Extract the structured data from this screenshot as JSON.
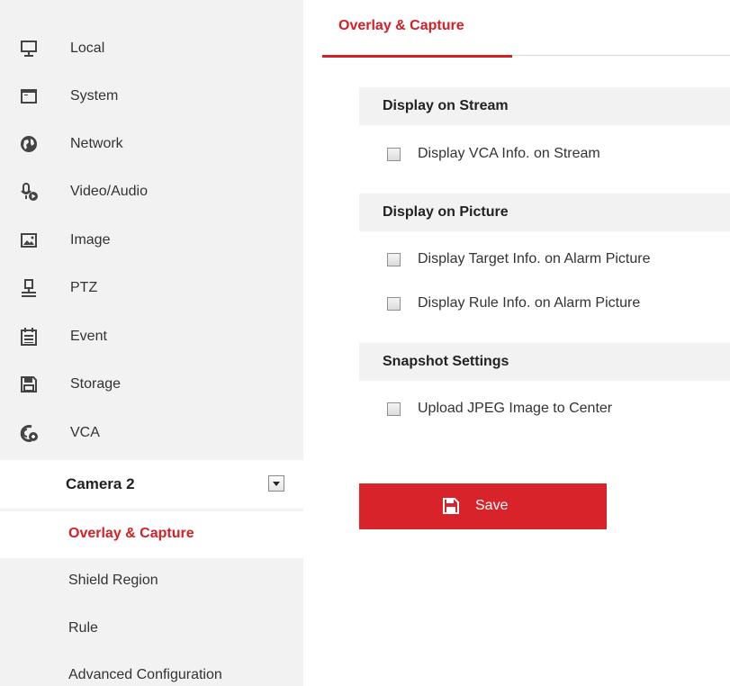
{
  "sidebar": {
    "items": [
      {
        "label": "Local",
        "icon": "monitor-icon"
      },
      {
        "label": "System",
        "icon": "window-icon"
      },
      {
        "label": "Network",
        "icon": "globe-icon"
      },
      {
        "label": "Video/Audio",
        "icon": "mic-camera-icon"
      },
      {
        "label": "Image",
        "icon": "image-icon"
      },
      {
        "label": "PTZ",
        "icon": "ptz-icon"
      },
      {
        "label": "Event",
        "icon": "calendar-icon"
      },
      {
        "label": "Storage",
        "icon": "floppy-icon"
      },
      {
        "label": "VCA",
        "icon": "vca-icon"
      }
    ],
    "camera": {
      "label": "Camera 2"
    },
    "subitems": [
      {
        "label": "Overlay & Capture",
        "active": true
      },
      {
        "label": "Shield Region",
        "active": false
      },
      {
        "label": "Rule",
        "active": false
      },
      {
        "label": "Advanced Configuration",
        "active": false
      }
    ]
  },
  "main": {
    "tab": {
      "label": "Overlay & Capture"
    },
    "sections": [
      {
        "title": "Display on Stream",
        "options": [
          {
            "label": "Display VCA Info. on Stream",
            "checked": false
          }
        ]
      },
      {
        "title": "Display on Picture",
        "options": [
          {
            "label": "Display Target Info. on Alarm Picture",
            "checked": false
          },
          {
            "label": "Display Rule Info. on Alarm Picture",
            "checked": false
          }
        ]
      },
      {
        "title": "Snapshot Settings",
        "options": [
          {
            "label": "Upload JPEG Image to Center",
            "checked": false
          }
        ]
      }
    ],
    "save_label": "Save"
  },
  "colors": {
    "accent": "#d41f26",
    "sidebar_bg": "#f2f2f2",
    "section_bg": "#f2f2f2"
  }
}
